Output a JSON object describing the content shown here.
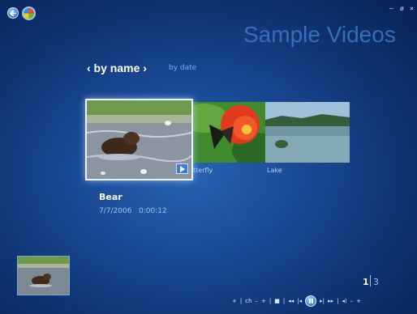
{
  "window": {
    "title": "Sample Videos",
    "controls": {
      "minimize": "–",
      "restore": "ø",
      "close": "×"
    }
  },
  "sort": {
    "by_name": "‹ by name ›",
    "by_date": "by date"
  },
  "gallery": {
    "items": [
      {
        "name": "Bear",
        "label": "",
        "icon": "video-thumbnail",
        "selected": true
      },
      {
        "name": "Butterfly",
        "label": "tterfly",
        "icon": "video-thumbnail"
      },
      {
        "name": "Lake",
        "label": "Lake",
        "icon": "video-thumbnail"
      }
    ]
  },
  "selected": {
    "title": "Bear",
    "date": "7/7/2006",
    "duration": "0:00:12",
    "meta": "7/7/2006   0:00:12"
  },
  "pager": {
    "current": "1",
    "total": "3"
  },
  "transport": {
    "items": [
      "+",
      "|",
      "ch",
      "–",
      "+",
      "|",
      "■",
      "|",
      "◂◂",
      "|◂",
      "play-pause",
      "▸|",
      "▸▸",
      "|",
      "◂)",
      "–",
      "+"
    ]
  },
  "colors": {
    "background": "#1a4a95",
    "title": "#3d78c5",
    "accent": "#6fb4ff"
  }
}
